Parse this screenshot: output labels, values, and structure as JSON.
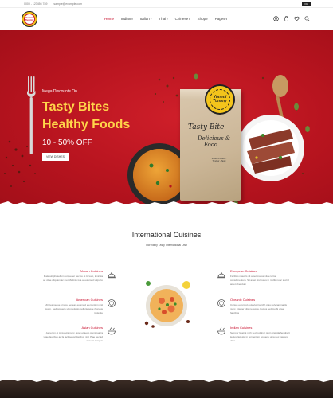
{
  "topbar": {
    "phone": "0000 - 123456 789",
    "email": "sample@example.com",
    "language": "FR"
  },
  "brand": {
    "logo_text": "Yummi Tummy"
  },
  "nav": {
    "items": [
      {
        "label": "Home",
        "caret": ""
      },
      {
        "label": "Indian",
        "caret": "▾"
      },
      {
        "label": "Italian",
        "caret": "▾"
      },
      {
        "label": "Thai",
        "caret": "▾"
      },
      {
        "label": "Chinese",
        "caret": "▾"
      },
      {
        "label": "Shop",
        "caret": "▾"
      },
      {
        "label": "Pages",
        "caret": "▾"
      }
    ],
    "active_index": 0
  },
  "header_icons": [
    "user-icon",
    "cart-icon",
    "heart-icon",
    "search-icon"
  ],
  "hero": {
    "eyebrow": "Mega Discounts On",
    "headline_line1": "Tasty Bites",
    "headline_line2": "Healthy Foods",
    "discount": "10 - 50% OFF",
    "button_label": "VIEW DISHES",
    "bag_logo": "Yummi Tummy",
    "bag_title": "Tasty Bite",
    "bag_subtitle_line1": "Delicious &",
    "bag_subtitle_line2": "Food",
    "bag_label": "Mutton Product - Tandoor - Tasty",
    "colors": {
      "background": "#b8141f",
      "headline": "#ffd54a"
    }
  },
  "section": {
    "title": "International Cuisines",
    "subtitle": "Incredibly Tasty International Dish"
  },
  "cuisines": {
    "left": [
      {
        "title": "African Cuisines",
        "desc": "Malesuit phasellum torquener nec ou at lorsuat, lenicola ac vitae aliquam ac met Mattinis is a al euismod vulpurio",
        "icon": "cloche-icon"
      },
      {
        "title": "American Cuisines",
        "desc": "Ultrices neque ornare aenean euismod elementum nisl quam. Sed posuere ulq pretiosis pellentesque rhoncus molestie",
        "icon": "dish-icon"
      },
      {
        "title": "Asian Cuisines",
        "desc": "Aenenon at torquegis nunc. Eget et aedo stemibuarra vitae faucibus ac fa facilise vel dapibus nisl. Plae nec ad aenean tempus",
        "icon": "bowl-icon"
      }
    ],
    "right": [
      {
        "title": "European Cuisines",
        "desc": "Facilisis maurris sit amet massa vitae tortor consdimentum. Sit amet nisl purus in mollis nunc sed id amet ribendum",
        "icon": "cloche-icon"
      },
      {
        "title": "Oceanic Cuisines",
        "desc": "Cursus euismod quis viverra nibh cras pulvinar mattis nunc. Integer vitia necessa. Luctus sed morbi vitae faucibus",
        "icon": "dish-icon"
      },
      {
        "title": "Indian Cuisines",
        "desc": "Semper feugiat nibh sed pulvinar proin gravida hendrerit lectus. Egesta in fermentum posuere urna nec nascere vitae",
        "icon": "bowl-icon"
      }
    ]
  },
  "colors": {
    "accent": "#c8102e",
    "brand_yellow": "#f3c41b"
  }
}
